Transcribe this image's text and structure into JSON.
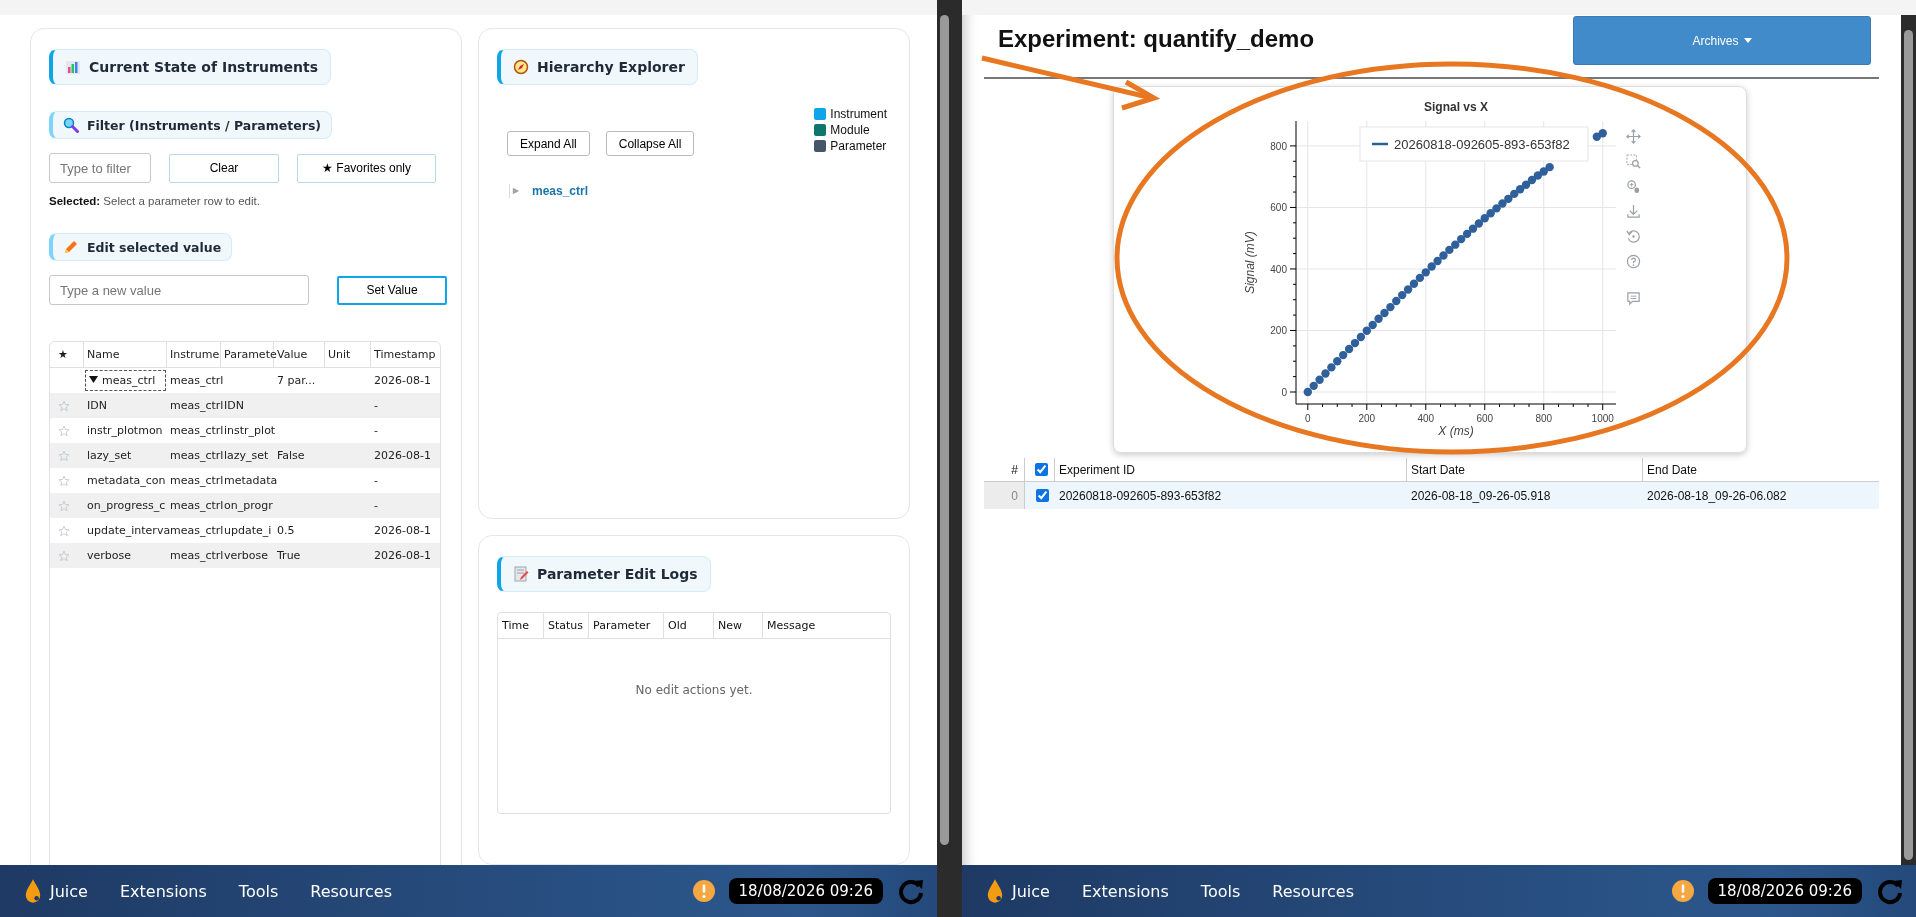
{
  "left_window": {
    "instruments_card": {
      "title": "Current State of Instruments",
      "filter": {
        "title": "Filter (Instruments / Parameters)",
        "placeholder": "Type to filter",
        "clear_button": "Clear",
        "favorites_button": "★ Favorites only"
      },
      "selected": {
        "label": "Selected:",
        "text": "Select a parameter row to edit."
      },
      "edit": {
        "title": "Edit selected value",
        "placeholder": "Type a new value",
        "button": "Set Value"
      },
      "table": {
        "columns": [
          "★",
          "Name",
          "Instrume",
          "Paramete",
          "Value",
          "Unit",
          "Timestamp"
        ],
        "rows": [
          {
            "kind": "group",
            "expanded": true,
            "focused": true,
            "name": "meas_ctrl",
            "instrument": "meas_ctrl",
            "value": "7 par...",
            "timestamp": "2026-08-1"
          },
          {
            "kind": "param",
            "favorite": false,
            "focused": false,
            "name": "IDN",
            "instrument": "meas_ctrl",
            "parameter": "IDN",
            "timestamp": "-"
          },
          {
            "kind": "param",
            "favorite": false,
            "focused": false,
            "name": "instr_plotmon",
            "instrument": "meas_ctrl",
            "parameter": "instr_plot",
            "timestamp": "-"
          },
          {
            "kind": "param",
            "favorite": false,
            "focused": false,
            "name": "lazy_set",
            "instrument": "meas_ctrl",
            "parameter": "lazy_set",
            "value": "False",
            "timestamp": "2026-08-1"
          },
          {
            "kind": "param",
            "favorite": false,
            "focused": false,
            "name": "metadata_con",
            "instrument": "meas_ctrl",
            "parameter": "metadata",
            "timestamp": "-"
          },
          {
            "kind": "param",
            "favorite": false,
            "focused": false,
            "name": "on_progress_c",
            "instrument": "meas_ctrl",
            "parameter": "on_progr",
            "timestamp": "-"
          },
          {
            "kind": "param",
            "favorite": false,
            "focused": false,
            "name": "update_interva",
            "instrument": "meas_ctrl",
            "parameter": "update_i",
            "value": "0.5",
            "timestamp": "2026-08-1"
          },
          {
            "kind": "param",
            "favorite": false,
            "focused": false,
            "name": "verbose",
            "instrument": "meas_ctrl",
            "parameter": "verbose",
            "value": "True",
            "timestamp": "2026-08-1"
          }
        ]
      }
    },
    "hierarchy_card": {
      "title": "Hierarchy Explorer",
      "buttons": [
        "Expand All",
        "Collapse All"
      ],
      "legend": [
        {
          "label": "Instrument",
          "color": "#0ea5e9"
        },
        {
          "label": "Module",
          "color": "#0f766e"
        },
        {
          "label": "Parameter",
          "color": "#475569"
        }
      ],
      "tree": [
        {
          "label": "meas_ctrl",
          "expanded": false
        }
      ]
    },
    "logs_card": {
      "title": "Parameter Edit Logs",
      "columns": [
        "Time",
        "Status",
        "Parameter",
        "Old",
        "New",
        "Message"
      ],
      "empty_message": "No edit actions yet."
    },
    "taskbar": {
      "brand": "Juice",
      "menu": [
        "Extensions",
        "Tools",
        "Resources"
      ],
      "datetime": "18/08/2026 09:26"
    }
  },
  "right_window": {
    "title": "Experiment: quantify_demo",
    "archives_button": "Archives",
    "chart": {
      "chart_data": {
        "type": "scatter",
        "title": "Signal vs X",
        "xlabel": "X (ms)",
        "ylabel": "Signal (mV)",
        "x": [
          0,
          20,
          40,
          60,
          80,
          100,
          120,
          140,
          160,
          180,
          200,
          220,
          240,
          260,
          280,
          300,
          320,
          340,
          360,
          380,
          400,
          420,
          440,
          460,
          480,
          500,
          520,
          540,
          560,
          580,
          600,
          620,
          640,
          660,
          680,
          700,
          720,
          740,
          760,
          780,
          800,
          820,
          980,
          1000
        ],
        "series": [
          {
            "name": "20260818-092605-893-653f82",
            "color": "#30609b",
            "values": [
              0,
              20,
              40,
              60,
              80,
              100,
              120,
              140,
              159,
              179,
              199,
              218,
              238,
              257,
              276,
              296,
              315,
              333,
              352,
              371,
              389,
              408,
              426,
              444,
              462,
              479,
              497,
              514,
              531,
              548,
              565,
              581,
              597,
              613,
              628,
              644,
              659,
              674,
              689,
              704,
              717,
              731,
              830,
              841
            ]
          }
        ],
        "xlim": [
          -40,
          1045
        ],
        "ylim": [
          -39,
          881
        ],
        "grid": true,
        "xticks": [
          0,
          200,
          400,
          600,
          800,
          1000
        ],
        "yticks": [
          0,
          200,
          400,
          600,
          800
        ]
      }
    },
    "table": {
      "index_header": "#",
      "columns": [
        "Experiment ID",
        "Start Date",
        "End Date"
      ],
      "all_checked": true,
      "rows": [
        {
          "index": "0",
          "checked": true,
          "selected": true,
          "cells": [
            "20260818-092605-893-653f82",
            "2026-08-18_09-26-05.918",
            "2026-08-18_09-26-06.082"
          ]
        }
      ]
    },
    "taskbar": {
      "brand": "Juice",
      "menu": [
        "Extensions",
        "Tools",
        "Resources"
      ],
      "datetime": "18/08/2026 09:26"
    }
  }
}
